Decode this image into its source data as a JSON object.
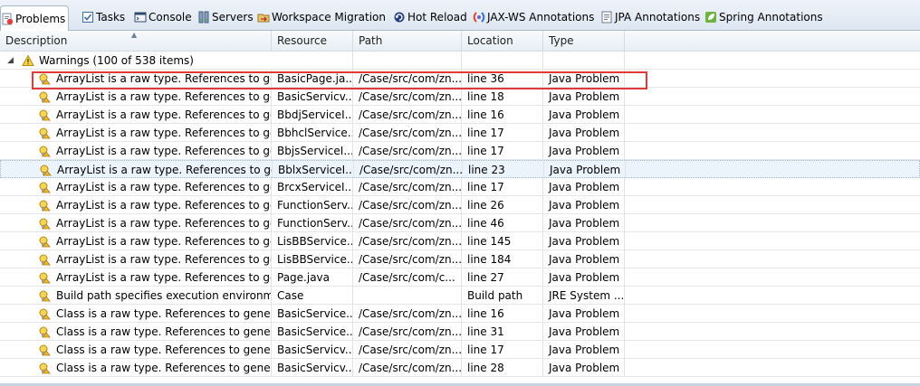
{
  "tabs": [
    {
      "label": "Problems",
      "icon": "problems-icon",
      "active": true
    },
    {
      "label": "Tasks",
      "icon": "tasks-icon",
      "active": false
    },
    {
      "label": "Console",
      "icon": "console-icon",
      "active": false
    },
    {
      "label": "Servers",
      "icon": "servers-icon",
      "active": false
    },
    {
      "label": "Workspace Migration",
      "icon": "workspace-migration-icon",
      "active": false
    },
    {
      "label": "Hot Reload",
      "icon": "hot-reload-icon",
      "active": false
    },
    {
      "label": "JAX-WS Annotations",
      "icon": "jaxws-icon",
      "active": false
    },
    {
      "label": "JPA Annotations",
      "icon": "jpa-icon",
      "active": false
    },
    {
      "label": "Spring Annotations",
      "icon": "spring-icon",
      "active": false
    }
  ],
  "columns": {
    "description": "Description",
    "resource": "Resource",
    "path": "Path",
    "location": "Location",
    "type": "Type"
  },
  "group": {
    "label": "Warnings (100 of 538 items)",
    "expanded": true
  },
  "rows": [
    {
      "description": "ArrayList is a raw type. References to generic type ArrayList<E> should be parameterized",
      "resource": "BasicPage.ja...",
      "path": "/Case/src/com/zn...",
      "location": "line 36",
      "type": "Java Problem"
    },
    {
      "description": "ArrayList is a raw type. References to generic type ArrayList<E> should be parameterized",
      "resource": "BasicServicv...",
      "path": "/Case/src/com/zn...",
      "location": "line 18",
      "type": "Java Problem"
    },
    {
      "description": "ArrayList is a raw type. References to generic type ArrayList<E> should be parameterized",
      "resource": "BbdjServiceI...",
      "path": "/Case/src/com/zn...",
      "location": "line 16",
      "type": "Java Problem"
    },
    {
      "description": "ArrayList is a raw type. References to generic type ArrayList<E> should be parameterized",
      "resource": "BbhclService...",
      "path": "/Case/src/com/zn...",
      "location": "line 17",
      "type": "Java Problem"
    },
    {
      "description": "ArrayList is a raw type. References to generic type ArrayList<E> should be parameterized",
      "resource": "BbjsServiceI...",
      "path": "/Case/src/com/zn...",
      "location": "line 17",
      "type": "Java Problem"
    },
    {
      "description": "ArrayList is a raw type. References to generic type ArrayList<E> should be parameterized",
      "resource": "BblxServiceI...",
      "path": "/Case/src/com/zn...",
      "location": "line 23",
      "type": "Java Problem"
    },
    {
      "description": "ArrayList is a raw type. References to generic type ArrayList<E> should be parameterized",
      "resource": "BrcxServiceI...",
      "path": "/Case/src/com/zn...",
      "location": "line 17",
      "type": "Java Problem"
    },
    {
      "description": "ArrayList is a raw type. References to generic type ArrayList<E> should be parameterized",
      "resource": "FunctionServ...",
      "path": "/Case/src/com/zn...",
      "location": "line 26",
      "type": "Java Problem"
    },
    {
      "description": "ArrayList is a raw type. References to generic type ArrayList<E> should be parameterized",
      "resource": "FunctionServ...",
      "path": "/Case/src/com/zn...",
      "location": "line 46",
      "type": "Java Problem"
    },
    {
      "description": "ArrayList is a raw type. References to generic type ArrayList<E> should be parameterized",
      "resource": "LisBBService...",
      "path": "/Case/src/com/zn...",
      "location": "line 145",
      "type": "Java Problem"
    },
    {
      "description": "ArrayList is a raw type. References to generic type ArrayList<E> should be parameterized",
      "resource": "LisBBService...",
      "path": "/Case/src/com/zn...",
      "location": "line 184",
      "type": "Java Problem"
    },
    {
      "description": "ArrayList is a raw type. References to generic type ArrayList<E> should be parameterized",
      "resource": "Page.java",
      "path": "/Case/src/com/c...",
      "location": "line 27",
      "type": "Java Problem"
    },
    {
      "description": "Build path specifies execution environment",
      "resource": "Case",
      "path": "",
      "location": "Build path",
      "type": "JRE System ..."
    },
    {
      "description": "Class is a raw type. References to generic type Class<T> should be parameterized",
      "resource": "BasicService...",
      "path": "/Case/src/com/zn...",
      "location": "line 16",
      "type": "Java Problem"
    },
    {
      "description": "Class is a raw type. References to generic type Class<T> should be parameterized",
      "resource": "BasicService...",
      "path": "/Case/src/com/zn...",
      "location": "line 31",
      "type": "Java Problem"
    },
    {
      "description": "Class is a raw type. References to generic type Class<T> should be parameterized",
      "resource": "BasicServicv...",
      "path": "/Case/src/com/zn...",
      "location": "line 17",
      "type": "Java Problem"
    },
    {
      "description": "Class is a raw type. References to generic type Class<T> should be parameterized",
      "resource": "BasicServicv...",
      "path": "/Case/src/com/zn...",
      "location": "line 28",
      "type": "Java Problem"
    }
  ],
  "colors": {
    "highlight": "#e03a3a",
    "warning": "#f2c12e",
    "focused_row": "#ebf3fc"
  }
}
